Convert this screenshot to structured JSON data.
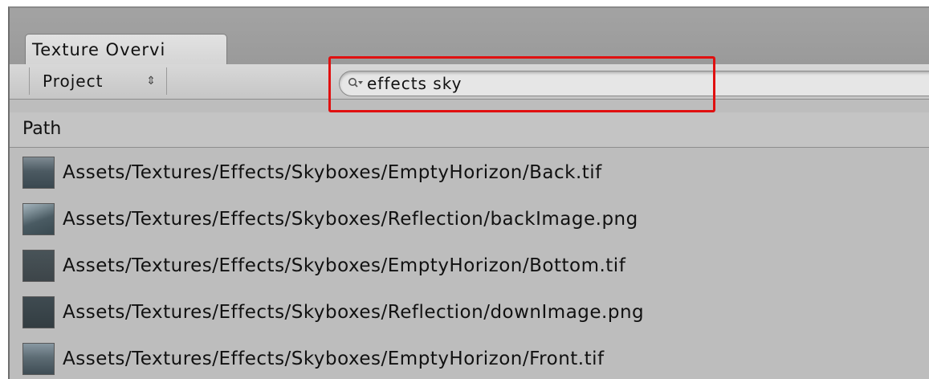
{
  "window": {
    "tab_title": "Texture Overvi"
  },
  "toolbar": {
    "project_label": "Project",
    "dropdown_arrows": "⇕",
    "search_query": "effects sky"
  },
  "table": {
    "header": "Path",
    "rows": [
      {
        "path": "Assets/Textures/Effects/Skyboxes/EmptyHorizon/Back.tif"
      },
      {
        "path": "Assets/Textures/Effects/Skyboxes/Reflection/backImage.png"
      },
      {
        "path": "Assets/Textures/Effects/Skyboxes/EmptyHorizon/Bottom.tif"
      },
      {
        "path": "Assets/Textures/Effects/Skyboxes/Reflection/downImage.png"
      },
      {
        "path": "Assets/Textures/Effects/Skyboxes/EmptyHorizon/Front.tif"
      }
    ]
  },
  "highlight_color": "#e01010",
  "icons": {
    "search": "magnifier-dropdown-icon"
  }
}
